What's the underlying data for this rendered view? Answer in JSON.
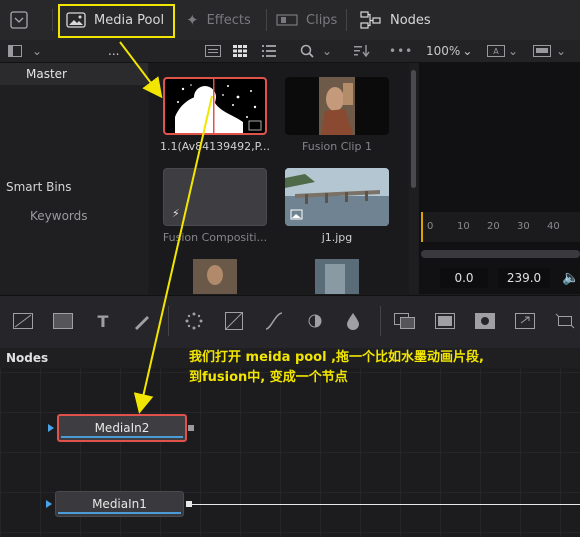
{
  "topbar": {
    "media_pool": "Media Pool",
    "effects": "Effects",
    "clips": "Clips",
    "nodes": "Nodes"
  },
  "toolbar2": {
    "dots": "...",
    "zoom": "100%",
    "more": "•••"
  },
  "sidebar": {
    "master": "Master",
    "smart_bins": "Smart Bins",
    "keywords": "Keywords"
  },
  "media_pool": {
    "clips": [
      {
        "label": "1.1(Av84139492,P..."
      },
      {
        "label": "Fusion Clip 1"
      },
      {
        "label": "Fusion Compositi..."
      },
      {
        "label": "j1.jpg"
      }
    ]
  },
  "viewer": {
    "ruler_ticks": [
      "0",
      "10",
      "20",
      "30",
      "40"
    ],
    "timecode_in": "0.0",
    "timecode_out": "239.0"
  },
  "nodes_panel": {
    "title": "Nodes",
    "annotation_line1": "我们打开 meida pool ,拖一个比如水墨动画片段,",
    "annotation_line2": "到fusion中, 变成一个节点",
    "node_media_in2": "MediaIn2",
    "node_media_in1": "MediaIn1"
  },
  "colors": {
    "highlight_yellow": "#f2e600",
    "selection_red": "#e0534a",
    "node_blue": "#4a9bd6"
  }
}
